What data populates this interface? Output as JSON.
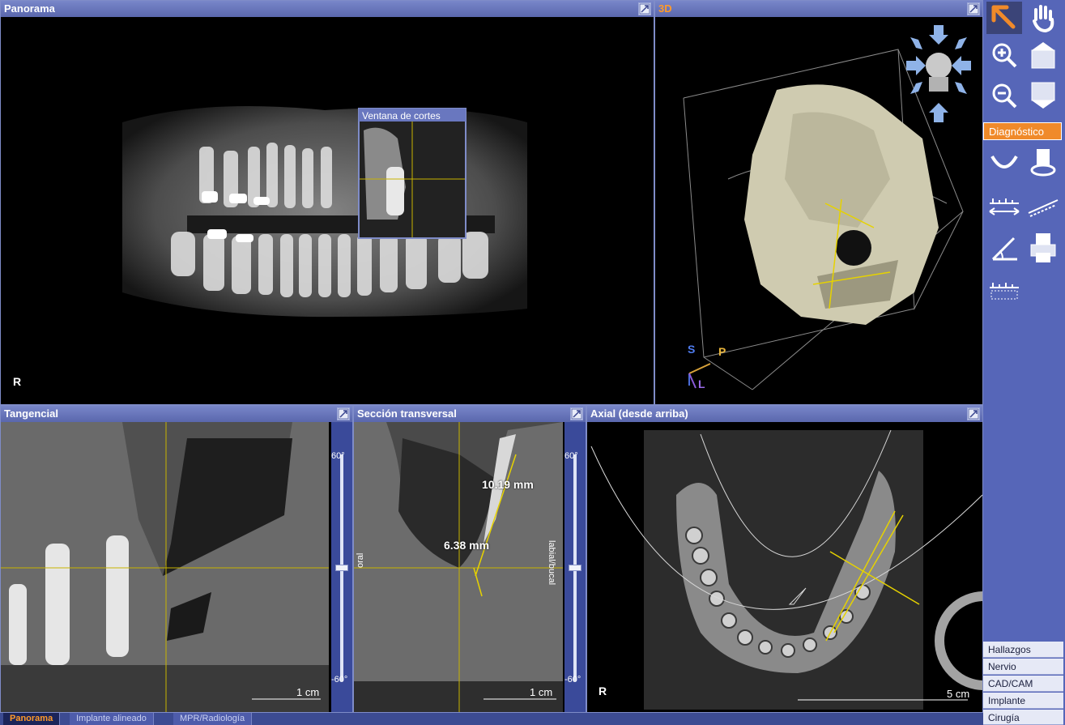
{
  "viewports": {
    "panorama": {
      "title": "Panorama",
      "side_marker": "R",
      "slice_window_title": "Ventana de cortes"
    },
    "view3d": {
      "title": "3D",
      "axes": {
        "s": "S",
        "p": "P",
        "l": "L"
      }
    },
    "tangential": {
      "title": "Tangencial",
      "scale": "1 cm",
      "slider_top": "60°",
      "slider_bottom": "-60°"
    },
    "cross_section": {
      "title": "Sección transversal",
      "scale": "1 cm",
      "slider_top": "60°",
      "slider_bottom": "-60°",
      "measure_1": "10.19 mm",
      "measure_2": "6.38 mm",
      "label_left": "oral",
      "label_right": "labial/bucal"
    },
    "axial": {
      "title": "Axial (desde arriba)",
      "side_marker": "R",
      "scale": "5 cm"
    }
  },
  "toolbar": {
    "tools": [
      {
        "name": "pointer-icon"
      },
      {
        "name": "hand-icon"
      },
      {
        "name": "zoom-in-icon"
      },
      {
        "name": "layer-up-icon"
      },
      {
        "name": "zoom-out-icon"
      },
      {
        "name": "layer-down-icon"
      }
    ],
    "section_label": "Diagnóstico",
    "diag_tools": [
      {
        "name": "arch-icon"
      },
      {
        "name": "nerve-icon"
      },
      {
        "name": "distance-icon"
      },
      {
        "name": "polyline-icon"
      },
      {
        "name": "angle-icon"
      },
      {
        "name": "print-icon"
      },
      {
        "name": "ruler-grid-icon"
      }
    ]
  },
  "side_menu": {
    "items": [
      "Hallazgos",
      "Nervio",
      "CAD/CAM",
      "Implante",
      "Cirugía"
    ]
  },
  "bottom_tabs": {
    "items": [
      "Panorama",
      "Implante alineado",
      "MPR/Radiología"
    ],
    "active": "Panorama"
  },
  "colors": {
    "frame": "#3c4b92",
    "title_bar": "#6977bf",
    "accent": "#f08a2a",
    "guide_line": "#c8b400"
  }
}
